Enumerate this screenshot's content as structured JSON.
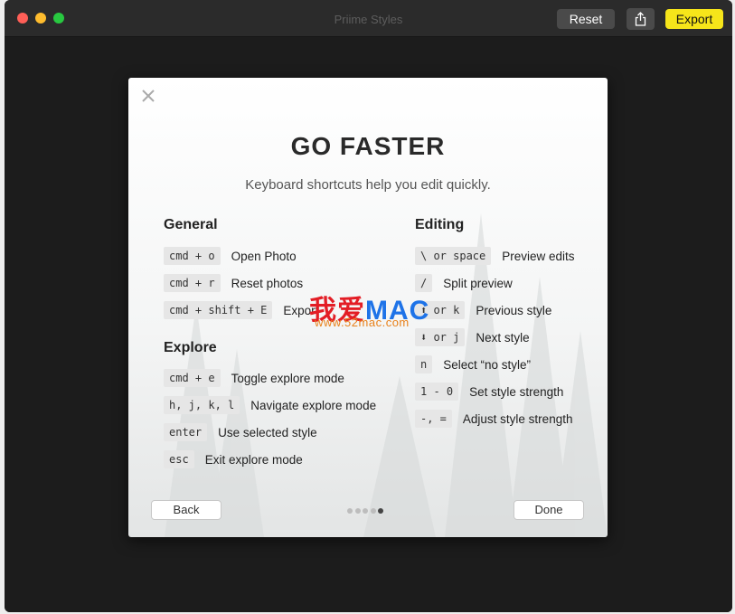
{
  "window": {
    "title": "Priime Styles"
  },
  "toolbar": {
    "reset_label": "Reset",
    "export_label": "Export",
    "share_icon": "share-icon"
  },
  "dialog": {
    "headline": "GO FASTER",
    "subtitle": "Keyboard shortcuts help you edit quickly.",
    "general": {
      "title": "General",
      "items": [
        {
          "key": "cmd + o",
          "label": "Open Photo"
        },
        {
          "key": "cmd + r",
          "label": "Reset photos"
        },
        {
          "key": "cmd + shift + E",
          "label": "Export"
        }
      ]
    },
    "explore": {
      "title": "Explore",
      "items": [
        {
          "key": "cmd + e",
          "label": "Toggle explore mode"
        },
        {
          "key": "h, j, k, l",
          "label": "Navigate explore mode"
        },
        {
          "key": "enter",
          "label": "Use selected style"
        },
        {
          "key": "esc",
          "label": "Exit explore mode"
        }
      ]
    },
    "editing": {
      "title": "Editing",
      "items": [
        {
          "key": "\\ or space",
          "label": "Preview edits"
        },
        {
          "key": "/",
          "label": "Split preview"
        },
        {
          "key": "⬆ or k",
          "label": "Previous style"
        },
        {
          "key": "⬇ or j",
          "label": "Next style"
        },
        {
          "key": "n",
          "label": "Select “no style”"
        },
        {
          "key": "1 - 0",
          "label": "Set style strength"
        },
        {
          "key": "-, =",
          "label": "Adjust style strength"
        }
      ]
    },
    "back_label": "Back",
    "done_label": "Done",
    "pagination": {
      "total": 5,
      "current": 5
    }
  },
  "watermark": {
    "brand_cn": "我爱",
    "brand_latin": "MAC",
    "url": "www.52mac.com"
  }
}
